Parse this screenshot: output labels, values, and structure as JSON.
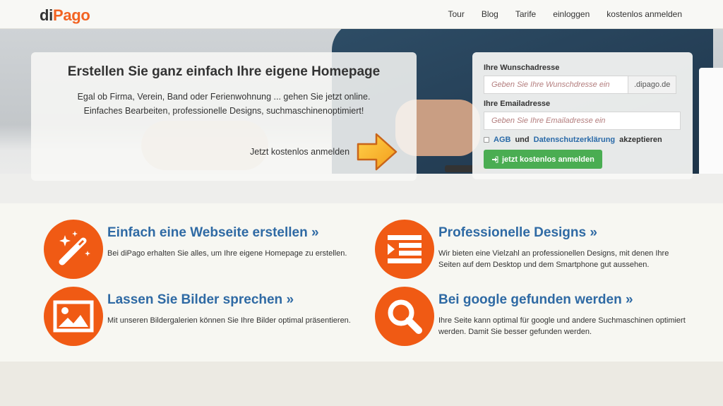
{
  "brand": {
    "logo_part1": "di",
    "logo_part2": "Pago",
    "accent": "#f26322"
  },
  "nav": {
    "items": [
      "Tour",
      "Blog",
      "Tarife",
      "einloggen",
      "kostenlos anmelden"
    ]
  },
  "hero": {
    "title": "Erstellen Sie ganz einfach Ihre eigene Homepage",
    "line1": "Egal ob Firma, Verein, Band oder Ferienwohnung ... gehen Sie jetzt online.",
    "line2": "Einfaches Bearbeiten, professionelle Designs, suchmaschinenoptimiert!",
    "cta": "Jetzt kostenlos anmelden"
  },
  "signup": {
    "address_label": "Ihre Wunschadresse",
    "address_placeholder": "Geben Sie Ihre Wunschdresse ein",
    "address_suffix": ".dipago.de",
    "email_label": "Ihre Emailadresse",
    "email_placeholder": "Geben Sie Ihre Emailadresse ein",
    "agb": "AGB",
    "and": "und",
    "privacy": "Datenschutzerklärung",
    "accept": "akzeptieren",
    "button": "jetzt kostenlos anmelden",
    "button_color": "#4aad52"
  },
  "features": [
    {
      "icon": "magic-wand-icon",
      "title": "Einfach eine Webseite erstellen »",
      "text": "Bei diPago erhalten Sie alles, um Ihre eigene Homepage zu erstellen."
    },
    {
      "icon": "layout-icon",
      "title": "Professionelle Designs »",
      "text": "Wir bieten eine Vielzahl an professionellen Designs, mit denen Ihre Seiten auf dem Desktop und dem Smartphone gut aussehen."
    },
    {
      "icon": "image-icon",
      "title": "Lassen Sie Bilder sprechen »",
      "text": "Mit unseren Bildergalerien können Sie Ihre Bilder optimal präsentieren."
    },
    {
      "icon": "search-icon",
      "title": "Bei google gefunden werden »",
      "text": "Ihre Seite kann optimal für google und andere Suchmaschinen optimiert werden. Damit Sie besser gefunden werden."
    }
  ],
  "colors": {
    "feature_circle": "#f05a14",
    "link_blue": "#2f6aa4"
  }
}
